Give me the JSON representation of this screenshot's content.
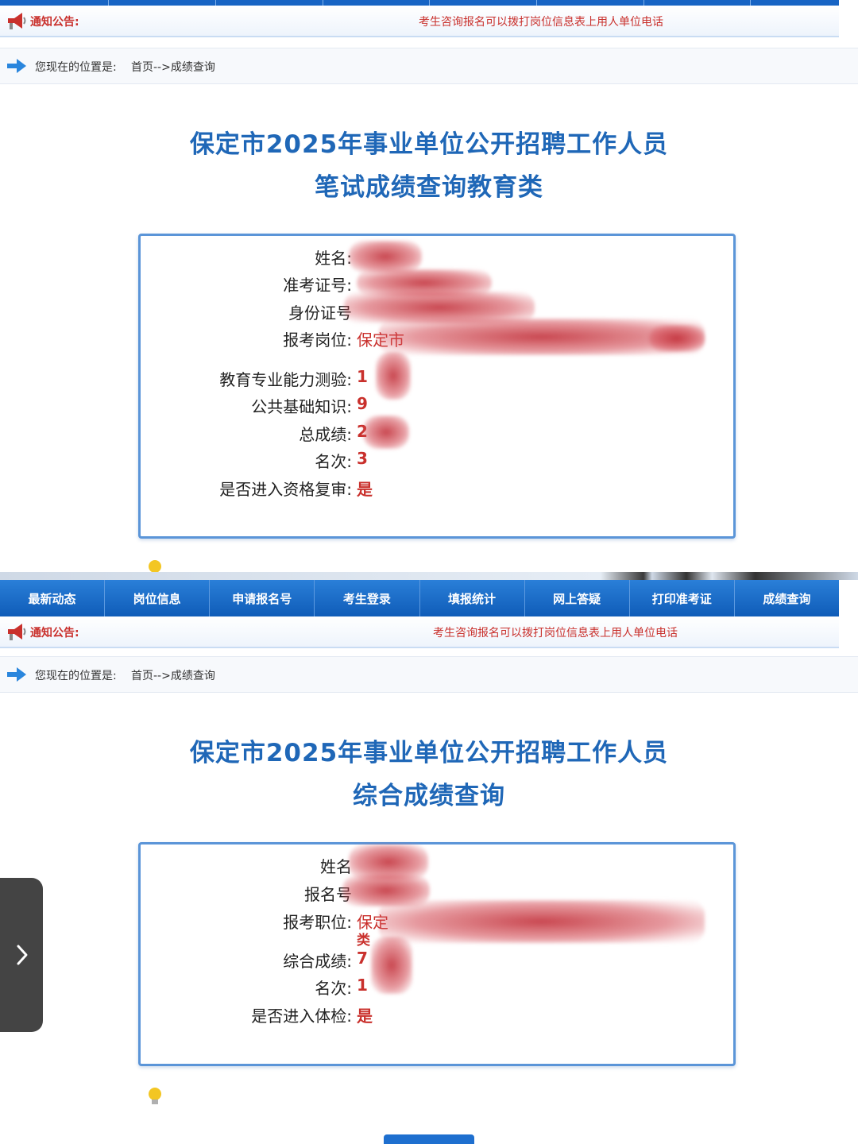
{
  "nav": {
    "items": [
      "最新动态",
      "岗位信息",
      "申请报名号",
      "考生登录",
      "填报统计",
      "网上答疑",
      "打印准考证",
      "成绩查询"
    ]
  },
  "notice": {
    "label": "通知公告:",
    "text_top": "考生咨询报名可以拨打岗位信息表上用人单位电话",
    "text_bottom": "考生咨询报名可以拨打岗位信息表上用人单位电话"
  },
  "location": {
    "label": "您现在的位置是:",
    "path": "首页-->成绩查询"
  },
  "written": {
    "title_line1": "保定市2025年事业单位公开招聘工作人员",
    "title_line2": "笔试成绩查询教育类",
    "rows": [
      {
        "label": "姓名:",
        "value": ""
      },
      {
        "label": "准考证号:",
        "value": ""
      },
      {
        "label": "身份证号",
        "value": ""
      },
      {
        "label": "报考岗位:",
        "value": "保定市"
      },
      {
        "label": "教育专业能力测验:",
        "value": "1"
      },
      {
        "label": "公共基础知识:",
        "value": "9"
      },
      {
        "label": "总成绩:",
        "value": "2"
      },
      {
        "label": "名次:",
        "value": "3"
      },
      {
        "label": "是否进入资格复审:",
        "value": "是"
      }
    ]
  },
  "overall": {
    "title_line1": "保定市2025年事业单位公开招聘工作人员",
    "title_line2": "综合成绩查询",
    "rows": [
      {
        "label": "姓名",
        "value": ""
      },
      {
        "label": "报名号",
        "value": ""
      },
      {
        "label": "报考职位:",
        "value": "保定"
      },
      {
        "label": "",
        "value": "类"
      },
      {
        "label": "综合成绩:",
        "value": "7"
      },
      {
        "label": "名次:",
        "value": "1"
      },
      {
        "label": "是否进入体检:",
        "value": "是"
      }
    ]
  },
  "colors": {
    "nav_blue": "#1764c4",
    "title_blue": "#1f67b7",
    "value_red": "#c9302c",
    "box_border": "#5b95d8"
  },
  "icons": [
    "megaphone-icon",
    "arrow-right-icon",
    "bulb-icon",
    "chevron-right-icon"
  ]
}
